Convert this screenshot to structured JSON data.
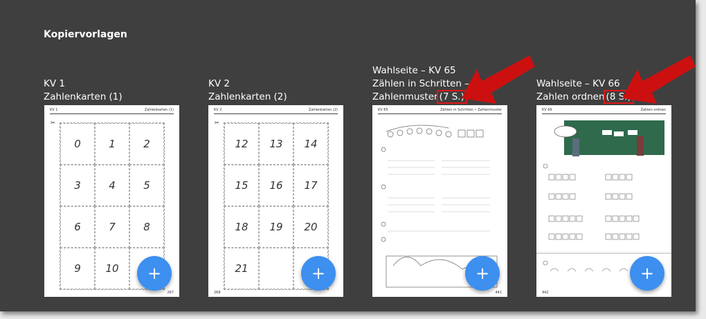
{
  "section": {
    "title": "Kopiervorlagen"
  },
  "cards": [
    {
      "line1": "KV 1",
      "line2": "Zahlenkarten (1)",
      "head_left": "KV 1",
      "head_right": "Zahlenkarten (1)",
      "page": "267",
      "numbers": [
        "0",
        "1",
        "2",
        "3",
        "4",
        "5",
        "6",
        "7",
        "8",
        "9",
        "10",
        ""
      ]
    },
    {
      "line1": "KV 2",
      "line2": "Zahlenkarten (2)",
      "head_left": "KV 2",
      "head_right": "Zahlenkarten (2)",
      "page": "268",
      "numbers": [
        "12",
        "13",
        "14",
        "15",
        "16",
        "17",
        "18",
        "19",
        "20",
        "21",
        "",
        ""
      ]
    },
    {
      "line1": "Wahlseite – KV 65",
      "line2": "Zählen in Schritten –",
      "line3": "Zahlenmuster",
      "pages_badge": "(7 S.)",
      "head_left": "KV 65",
      "head_right": "Zählen in Schritten • Zahlenmuster",
      "page": "441"
    },
    {
      "line1": "Wahlseite – KV 66",
      "line2": "Zahlen ordnen",
      "pages_badge": "(8 S.)",
      "head_left": "KV 66",
      "head_right": "Zahlen ordnen",
      "page": "442"
    }
  ],
  "add_button": {
    "label": "+"
  },
  "colors": {
    "background": "#3f3f3f",
    "fab": "#3d8ff0",
    "arrow": "#cc1010",
    "highlight": "#e01818"
  }
}
